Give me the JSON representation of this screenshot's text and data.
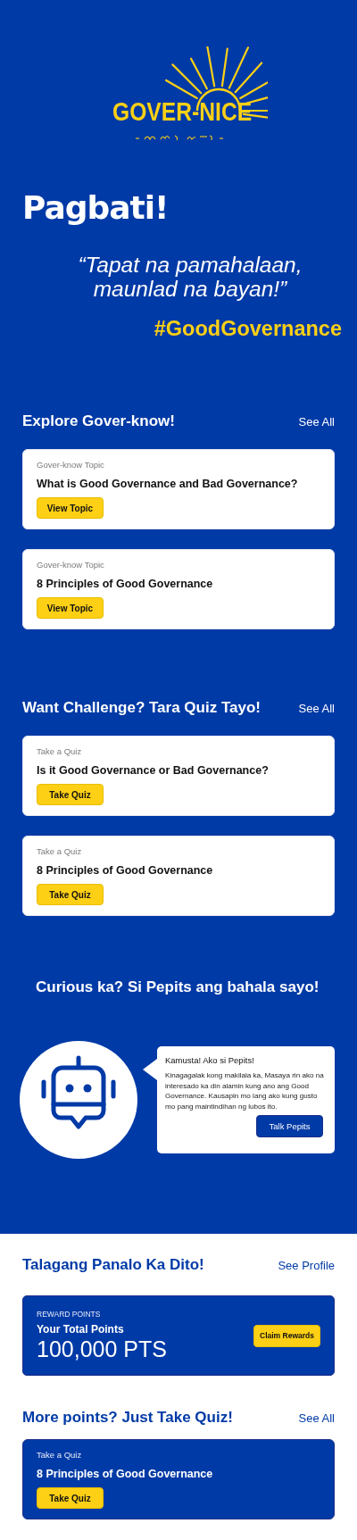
{
  "logo": {
    "name": "GOVER-NICE"
  },
  "greeting": {
    "title": "Pagbati!",
    "quote": "“Tapat na pamahalaan, maunlad na bayan!”",
    "hashtag": "#GoodGovernance"
  },
  "topics": {
    "heading": "Explore Gover-know!",
    "see_all": "See All",
    "items": [
      {
        "label": "Gover-know Topic",
        "title": "What is Good Governance and Bad Governance?",
        "button": "View Topic"
      },
      {
        "label": "Gover-know Topic",
        "title": "8 Principles of Good Governance",
        "button": "View Topic"
      }
    ]
  },
  "quizzes": {
    "heading": "Want Challenge? Tara Quiz Tayo!",
    "see_all": "See All",
    "items": [
      {
        "label": "Take a Quiz",
        "title": "Is it Good Governance or Bad Governance?",
        "button": "Take Quiz"
      },
      {
        "label": "Take a Quiz",
        "title": "8 Principles of Good Governance",
        "button": "Take Quiz"
      }
    ]
  },
  "chatbot": {
    "heading": "Curious ka? Si Pepits ang bahala sayo!",
    "greeting": "Kamusta! Ako si Pepits!",
    "message": "Kinagagalak kong makilala ka, Masaya rin ako na interesado ka din alamin kung ano ang Good Governance. Kausapin mo lang ako kung gusto mo pang maintindihan ng lubos ito.",
    "button": "Talk Pepits"
  },
  "rewards": {
    "heading": "Talagang Panalo Ka Dito!",
    "link": "See Profile",
    "label": "REWARD POINTS",
    "subtitle": "Your Total Points",
    "points": "100,000 PTS",
    "button": "Claim Rewards"
  },
  "more_quizzes": {
    "heading": "More points? Just Take Quiz!",
    "see_all": "See All",
    "items": [
      {
        "label": "Take a Quiz",
        "title": "8 Principles of Good Governance",
        "button": "Take Quiz"
      }
    ]
  }
}
